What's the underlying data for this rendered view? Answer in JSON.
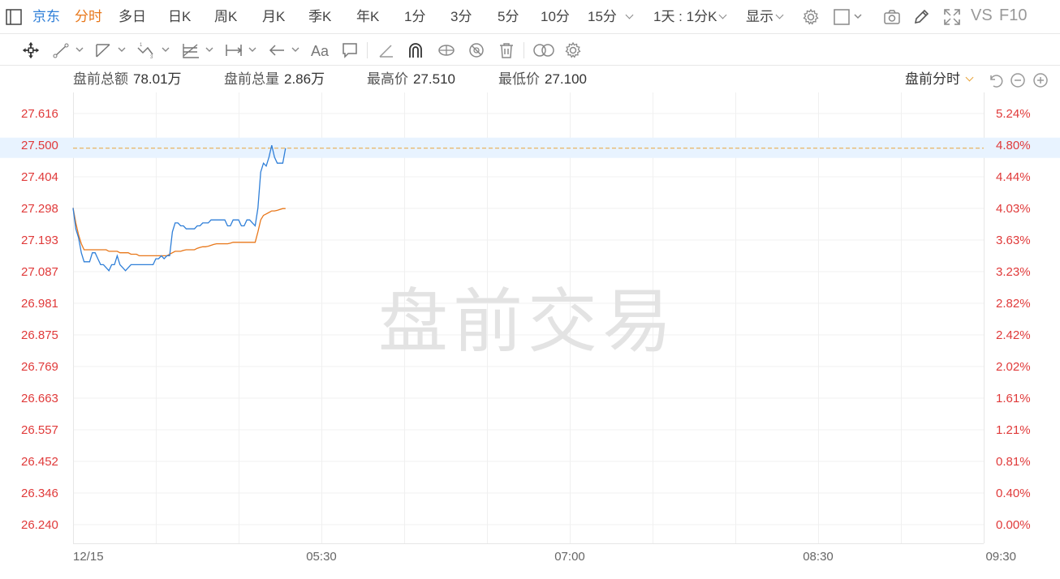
{
  "toolbar": {
    "stock_name": "京东",
    "periods": [
      "分时",
      "多日",
      "日K",
      "周K",
      "月K",
      "季K",
      "年K",
      "1分",
      "3分",
      "5分",
      "10分",
      "15分"
    ],
    "range_select": "1天 : 1分K",
    "display_label": "显示",
    "vs_label": "VS",
    "f10_label": "F10"
  },
  "stats": {
    "turnover_label": "盘前总额",
    "turnover_value": "78.01万",
    "volume_label": "盘前总量",
    "volume_value": "2.86万",
    "high_label": "最高价",
    "high_value": "27.510",
    "low_label": "最低价",
    "low_value": "27.100",
    "mode_label": "盘前分时"
  },
  "colors": {
    "price_line": "#2f7fd8",
    "avg_line": "#e8771a",
    "axis_red": "#e03a3a",
    "ref_line": "#e8a33a",
    "highlight_bg": "#e8f3ff"
  },
  "chart_data": {
    "type": "line",
    "watermark": "盘前交易",
    "x_ticks": [
      "12/15",
      "05:30",
      "07:00",
      "08:30",
      "09:30"
    ],
    "y_left_ticks": [
      "27.616",
      "27.500",
      "27.404",
      "27.298",
      "27.193",
      "27.087",
      "26.981",
      "26.875",
      "26.769",
      "26.663",
      "26.557",
      "26.452",
      "26.346",
      "26.240"
    ],
    "y_right_ticks": [
      "5.24%",
      "4.80%",
      "4.44%",
      "4.03%",
      "3.63%",
      "3.23%",
      "2.82%",
      "2.42%",
      "2.02%",
      "1.61%",
      "1.21%",
      "0.81%",
      "0.40%",
      "0.00%"
    ],
    "ylim": [
      26.24,
      27.616
    ],
    "current_price": "27.500",
    "current_pct": "4.80%",
    "total_minutes": 330,
    "series": [
      {
        "key": "price",
        "values": [
          27.3,
          27.23,
          27.2,
          27.15,
          27.12,
          27.12,
          27.12,
          27.15,
          27.15,
          27.13,
          27.11,
          27.11,
          27.1,
          27.09,
          27.11,
          27.11,
          27.14,
          27.11,
          27.1,
          27.09,
          27.1,
          27.11,
          27.11,
          27.11,
          27.11,
          27.11,
          27.11,
          27.11,
          27.11,
          27.11,
          27.13,
          27.13,
          27.14,
          27.13,
          27.14,
          27.14,
          27.22,
          27.25,
          27.25,
          27.24,
          27.24,
          27.23,
          27.23,
          27.23,
          27.23,
          27.24,
          27.24,
          27.25,
          27.25,
          27.25,
          27.26,
          27.26,
          27.26,
          27.26,
          27.26,
          27.26,
          27.24,
          27.24,
          27.26,
          27.26,
          27.26,
          27.24,
          27.24,
          27.26,
          27.26,
          27.25,
          27.24,
          27.3,
          27.42,
          27.45,
          27.44,
          27.47,
          27.51,
          27.47,
          27.45,
          27.45,
          27.45,
          27.5
        ]
      },
      {
        "key": "average",
        "values": [
          27.3,
          27.25,
          27.21,
          27.18,
          27.16,
          27.16,
          27.16,
          27.16,
          27.16,
          27.16,
          27.16,
          27.16,
          27.16,
          27.155,
          27.155,
          27.155,
          27.155,
          27.15,
          27.15,
          27.15,
          27.15,
          27.145,
          27.145,
          27.145,
          27.14,
          27.14,
          27.14,
          27.14,
          27.14,
          27.14,
          27.14,
          27.14,
          27.14,
          27.14,
          27.14,
          27.145,
          27.15,
          27.155,
          27.155,
          27.155,
          27.158,
          27.16,
          27.16,
          27.16,
          27.16,
          27.165,
          27.168,
          27.17,
          27.17,
          27.172,
          27.175,
          27.178,
          27.18,
          27.18,
          27.18,
          27.18,
          27.18,
          27.182,
          27.185,
          27.185,
          27.185,
          27.185,
          27.185,
          27.185,
          27.185,
          27.185,
          27.185,
          27.22,
          27.26,
          27.275,
          27.28,
          27.285,
          27.29,
          27.29,
          27.292,
          27.295,
          27.298,
          27.298
        ]
      }
    ]
  }
}
